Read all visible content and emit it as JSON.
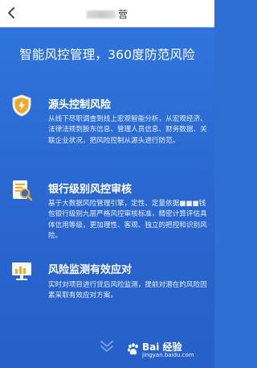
{
  "app_bar": {
    "title_suffix": "营"
  },
  "headline": "智能风控管理，360度防范风险",
  "sections": [
    {
      "icon": "shield-lightning-icon",
      "title": "源头控制风险",
      "body": "从线下尽职调查到线上宏观智能分析，从宏观经济、法律法规到股东信息、管理人员信息、财务数据、关联企业状况，把风险控制从源头进行防范。"
    },
    {
      "icon": "document-search-icon",
      "title": "银行级别风控审核",
      "body": "基于大数据风险管理引擎，定性、定量依据■■■钱包银行级别九层严格风控审核标准，精密计算评估具体信用等级，更加理性、客观、独立的把控和识别风险。"
    },
    {
      "icon": "monitor-chart-icon",
      "title": "风险监测有效应对",
      "body": "实时对项目进行贷后风险监测，提前对潜在的风险因素采取有效应对方案。"
    }
  ],
  "watermark": {
    "brand": "Bai 经验",
    "url": "jingyan.baidu.com"
  },
  "colors": {
    "background": "#2f6fd4",
    "icon_orange": "#f5a623",
    "icon_light": "#e8eef8"
  }
}
